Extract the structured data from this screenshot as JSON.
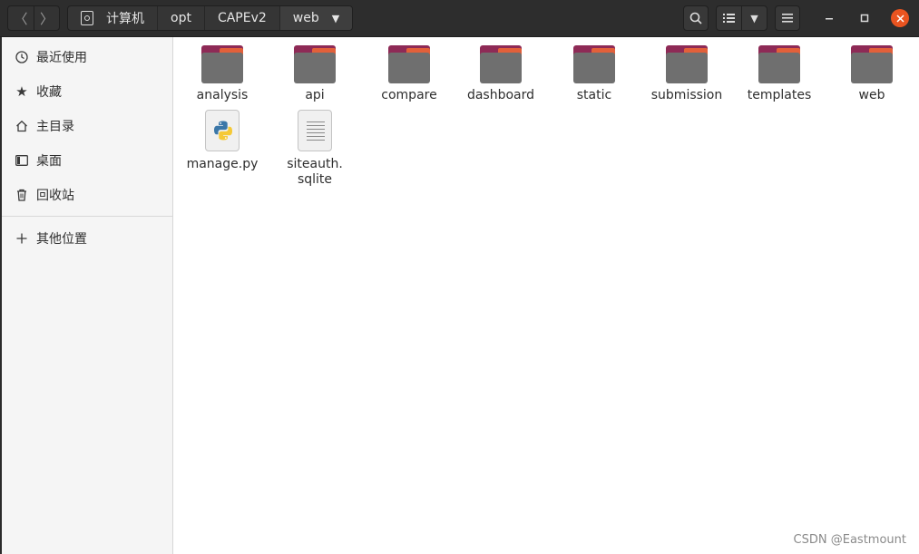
{
  "headerbar": {
    "back_icon": "chevron-left",
    "forward_icon": "chevron-right",
    "breadcrumbs": [
      "计算机",
      "opt",
      "CAPEv2",
      "web"
    ],
    "window_controls": [
      "minimize",
      "maximize",
      "close"
    ],
    "accent_color": "#e95420"
  },
  "sidebar": {
    "items": [
      {
        "label": "最近使用",
        "icon": "clock-icon"
      },
      {
        "label": "收藏",
        "icon": "star-icon"
      },
      {
        "label": "主目录",
        "icon": "home-icon"
      },
      {
        "label": "桌面",
        "icon": "desktop-icon"
      },
      {
        "label": "回收站",
        "icon": "trash-icon"
      }
    ],
    "other": {
      "label": "其他位置",
      "icon": "plus-icon"
    }
  },
  "files": [
    {
      "name": "analysis",
      "type": "folder"
    },
    {
      "name": "api",
      "type": "folder"
    },
    {
      "name": "compare",
      "type": "folder"
    },
    {
      "name": "dashboard",
      "type": "folder"
    },
    {
      "name": "static",
      "type": "folder"
    },
    {
      "name": "submission",
      "type": "folder"
    },
    {
      "name": "templates",
      "type": "folder"
    },
    {
      "name": "web",
      "type": "folder"
    },
    {
      "name": "manage.py",
      "type": "python"
    },
    {
      "name_line1": "siteauth.",
      "name_line2": "sqlite",
      "type": "text"
    }
  ],
  "watermark": "CSDN @Eastmount"
}
